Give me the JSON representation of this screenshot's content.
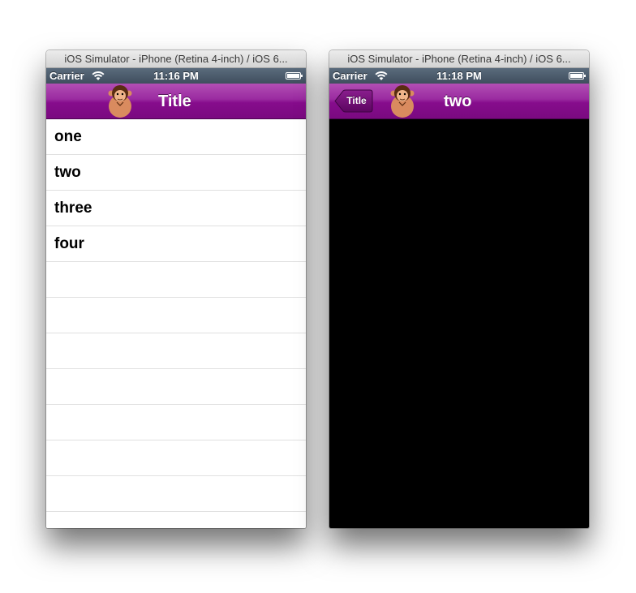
{
  "windows": [
    {
      "title": "iOS Simulator - iPhone (Retina 4-inch) / iOS 6...",
      "status": {
        "carrier": "Carrier",
        "time": "11:16 PM"
      },
      "nav": {
        "title": "Title",
        "avatar_icon": "monkey-icon"
      },
      "table": {
        "rows": [
          "one",
          "two",
          "three",
          "four",
          "",
          "",
          "",
          "",
          "",
          "",
          "",
          ""
        ]
      }
    },
    {
      "title": "iOS Simulator - iPhone (Retina 4-inch) / iOS 6...",
      "status": {
        "carrier": "Carrier",
        "time": "11:18 PM"
      },
      "nav": {
        "title": "two",
        "back_label": "Title",
        "avatar_icon": "monkey-icon"
      },
      "content": {
        "background": "#000000"
      }
    }
  ],
  "colors": {
    "navbar_purple": "#860c8c",
    "statusbar": "#4a5a6a",
    "content_black": "#000000"
  }
}
